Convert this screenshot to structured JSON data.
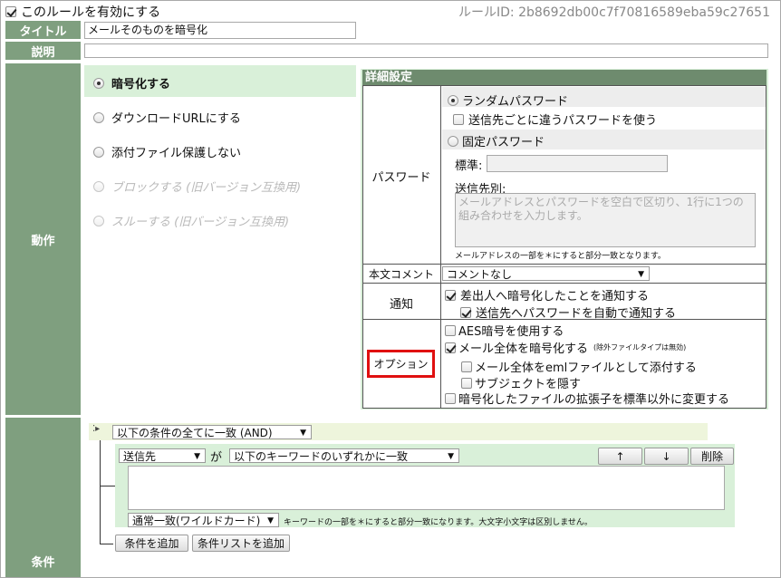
{
  "header": {
    "enable_rule_label": "このルールを有効にする",
    "rule_id_label": "ルールID:",
    "rule_id_value": "2b8692db00c7f70816589eba59c27651"
  },
  "fields": {
    "title_label": "タイトル",
    "title_value": "メールそのものを暗号化",
    "description_label": "説明",
    "description_value": ""
  },
  "action": {
    "label": "動作",
    "options": [
      {
        "label": "暗号化する",
        "selected": true,
        "disabled": false
      },
      {
        "label": "ダウンロードURLにする",
        "selected": false,
        "disabled": false
      },
      {
        "label": "添付ファイル保護しない",
        "selected": false,
        "disabled": false
      },
      {
        "label": "ブロックする (旧バージョン互換用)",
        "selected": false,
        "disabled": true
      },
      {
        "label": "スルーする (旧バージョン互換用)",
        "selected": false,
        "disabled": true
      }
    ]
  },
  "details": {
    "header": "詳細設定",
    "password": {
      "label": "パスワード",
      "random_label": "ランダムパスワード",
      "per_recipient_label": "送信先ごとに違うパスワードを使う",
      "fixed_label": "固定パスワード",
      "standard_label": "標準:",
      "standard_value": "",
      "per_recipient_field_label": "送信先別:",
      "per_recipient_placeholder": "メールアドレスとパスワードを空白で区切り、1行に1つの組み合わせを入力します。",
      "note": "メールアドレスの一部を＊にすると部分一致となります。"
    },
    "body_comment": {
      "label": "本文コメント",
      "value": "コメントなし"
    },
    "notify": {
      "label": "通知",
      "notify_sender_label": "差出人へ暗号化したことを通知する",
      "auto_notify_label": "送信先へパスワードを自動で通知する"
    },
    "options": {
      "label": "オプション",
      "aes_label": "AES暗号を使用する",
      "encrypt_whole_label": "メール全体を暗号化する",
      "encrypt_whole_note": "(除外ファイルタイプは無効)",
      "attach_eml_label": "メール全体をemlファイルとして添付する",
      "hide_subject_label": "サブジェクトを隠す",
      "change_ext_label": "暗号化したファイルの拡張子を標準以外に変更する"
    }
  },
  "conditions": {
    "label": "条件",
    "match_mode": "以下の条件の全てに一致 (AND)",
    "field_select": "送信先",
    "ga": "が",
    "keyword_mode": "以下のキーワードのいずれかに一致",
    "up_label": "↑",
    "down_label": "↓",
    "delete_label": "削除",
    "keywords_value": "",
    "match_type": "通常一致(ワイルドカード)",
    "match_note": "キーワードの一部を＊にすると部分一致になります。大文字小文字は区別しません。",
    "add_condition_label": "条件を追加",
    "add_condition_list_label": "条件リストを追加"
  },
  "colors": {
    "label_bg": "#7f9f7f",
    "details_header_bg": "#6e8b6e",
    "selected_bg": "#d9f0d9",
    "highlight_red": "#e01010",
    "cond_bg": "#eef5dc"
  }
}
